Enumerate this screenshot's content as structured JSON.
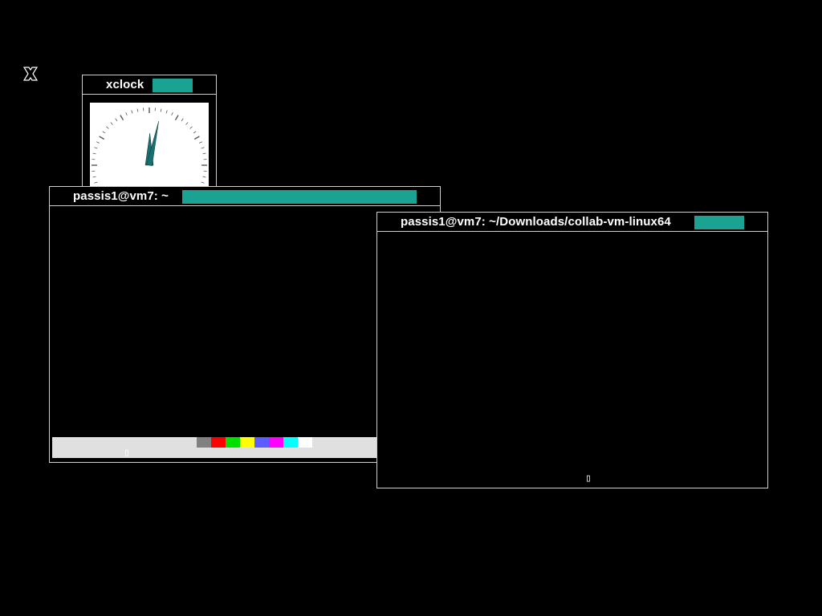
{
  "root": {
    "cursor_icon": "x-cursor-icon"
  },
  "xclock_window": {
    "title": "xclock",
    "accent_color": "#1aa393",
    "clock": {
      "hour": 12,
      "minute": 2
    }
  },
  "terminal_1": {
    "title": "passis1@vm7: ~",
    "accent_color": "#1aa393",
    "cursor_char": "▯",
    "color_bar": {
      "background": "#e0e0e0",
      "swatches": [
        {
          "name": "gray",
          "color": "#808080"
        },
        {
          "name": "red",
          "color": "#ff0000"
        },
        {
          "name": "green",
          "color": "#00e000"
        },
        {
          "name": "yellow",
          "color": "#ffff00"
        },
        {
          "name": "blue",
          "color": "#5c5cff"
        },
        {
          "name": "magenta",
          "color": "#ff00ff"
        },
        {
          "name": "cyan",
          "color": "#00ffff"
        },
        {
          "name": "white",
          "color": "#ffffff"
        }
      ]
    }
  },
  "terminal_2": {
    "title": "passis1@vm7: ~/Downloads/collab-vm-linux64",
    "accent_color": "#1aa393",
    "cursor_char": "▯"
  }
}
